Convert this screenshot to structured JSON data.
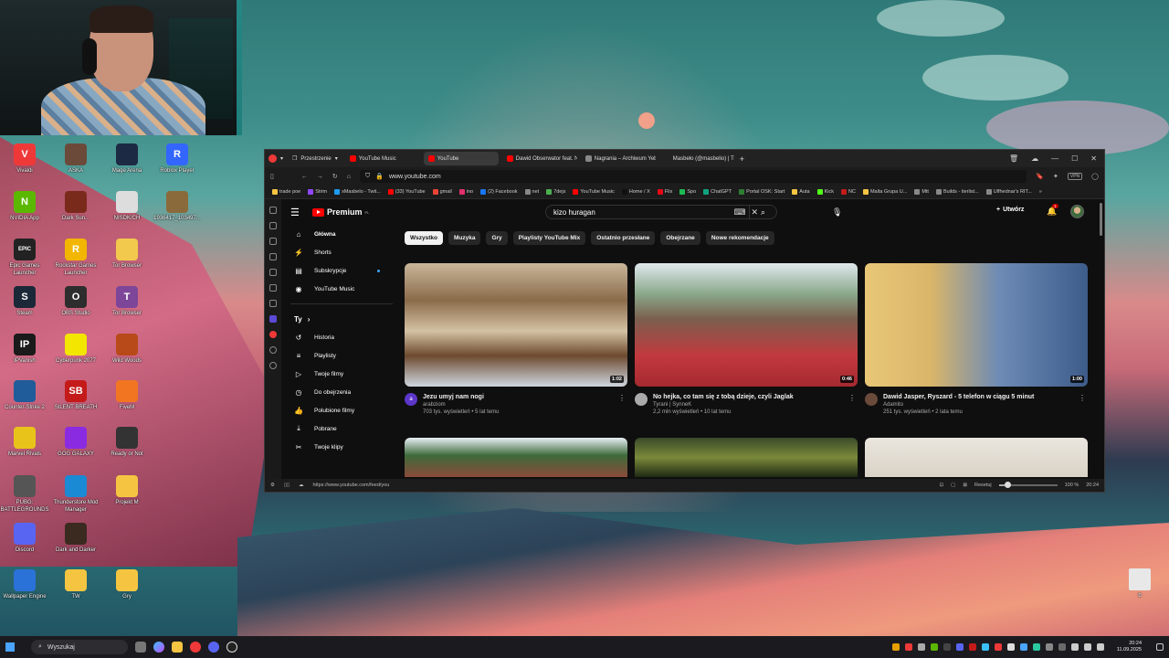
{
  "desktop": {
    "icons": [
      {
        "label": "Vivaldi",
        "color": "#ef3939",
        "glyph": "V"
      },
      {
        "label": "ASKA",
        "color": "#6b4a3a",
        "glyph": ""
      },
      {
        "label": "Mage Arena",
        "color": "#1d2a44",
        "glyph": ""
      },
      {
        "label": "Roblox Player",
        "color": "#3366ff",
        "glyph": "R"
      },
      {
        "label": "NVIDIA App",
        "color": "#5bb800",
        "glyph": "N"
      },
      {
        "label": "Dark Sun...",
        "color": "#7a2a1a",
        "glyph": ""
      },
      {
        "label": "NISDK/CH",
        "color": "#dddddd",
        "glyph": ""
      },
      {
        "label": "1936417_103497...",
        "color": "#8a6a3a",
        "glyph": ""
      },
      {
        "label": "Epic Games Launcher",
        "color": "#222222",
        "glyph": "EPIC"
      },
      {
        "label": "Rockstar Games Launcher",
        "color": "#f2b600",
        "glyph": "R"
      },
      {
        "label": "Tor Browser",
        "color": "#f2c94c",
        "glyph": ""
      },
      {
        "label": "Steam",
        "color": "#1b2838",
        "glyph": "S"
      },
      {
        "label": "OBS Studio",
        "color": "#2d2d2d",
        "glyph": "O"
      },
      {
        "label": "Tor Browser",
        "color": "#7d4698",
        "glyph": "T"
      },
      {
        "label": "IPVanish",
        "color": "#1a1a1a",
        "glyph": "IP"
      },
      {
        "label": "Cyberpunk 2077",
        "color": "#f3e600",
        "glyph": ""
      },
      {
        "label": "Wild Woods",
        "color": "#b84a1a",
        "glyph": ""
      },
      {
        "label": "Counter-Strike 2",
        "color": "#1f5c99",
        "glyph": ""
      },
      {
        "label": "SILENT BREATH",
        "color": "#c41a1a",
        "glyph": "SB"
      },
      {
        "label": "FiveM",
        "color": "#f27521",
        "glyph": ""
      },
      {
        "label": "Marvel Rivals",
        "color": "#e8c31a",
        "glyph": ""
      },
      {
        "label": "GOG GALAXY",
        "color": "#8a2be2",
        "glyph": ""
      },
      {
        "label": "Ready or Not",
        "color": "#333333",
        "glyph": ""
      },
      {
        "label": "PUBG: BATTLEGROUNDS",
        "color": "#555555",
        "glyph": ""
      },
      {
        "label": "Thunderstore Mod Manager",
        "color": "#1b8ad4",
        "glyph": ""
      },
      {
        "label": "Projekt M",
        "color": "#f5c542",
        "glyph": ""
      },
      {
        "label": "Discord",
        "color": "#5865f2",
        "glyph": ""
      },
      {
        "label": "Dark and Darker",
        "color": "#3a2a20",
        "glyph": ""
      },
      {
        "label": "Wallpaper Engine",
        "color": "#2a72d8",
        "glyph": ""
      },
      {
        "label": "TW",
        "color": "#f5c542",
        "glyph": ""
      },
      {
        "label": "Gry",
        "color": "#f5c542",
        "glyph": ""
      }
    ],
    "right_icon_label": "b"
  },
  "browser": {
    "workspace_label": "Przestrzenie",
    "tabs": [
      {
        "title": "YouTube Music",
        "color": "#ff0000"
      },
      {
        "title": "YouTube",
        "color": "#ff0000"
      },
      {
        "title": "Dawid Obserwator feat. Ni...",
        "color": "#ff0000"
      },
      {
        "title": "Nagrania – Archiwum Yebo",
        "color": "#888888"
      },
      {
        "title": "Masbeło (@masbelio) | Tik",
        "color": "#222222"
      }
    ],
    "url": "www.youtube.com",
    "bookmarks": [
      "trade poe",
      "Strim",
      "xMasbelo - Twit...",
      "(33) YouTube",
      "gmail",
      "ino",
      "(2) Facebook",
      "net",
      "7dejs",
      "YouTube Music",
      "Home / X",
      "Flix",
      "Spo",
      "ChatGPT",
      "Portal OSK: Start",
      "Auta",
      "Kick",
      "NC",
      "Malta Grupa U...",
      "Mtt",
      "Builds - tierlist...",
      "Ulfhednar's RIT..."
    ],
    "status_url": "https://www.youtube.com/feed/you",
    "reset_label": "Resetuj",
    "zoom_level": "100 %",
    "zoom_fraction": 0.15,
    "status_time": "20:24"
  },
  "youtube": {
    "logo_text": "Premium",
    "logo_sup": "PL",
    "search_value": "kizo huragan",
    "create_label": "Utwórz",
    "notif_count": "1",
    "sidebar": {
      "main": [
        {
          "label": "Główna",
          "icon": "⌂",
          "name": "home-icon"
        },
        {
          "label": "Shorts",
          "icon": "⚡",
          "name": "shorts-icon"
        },
        {
          "label": "Subskrypcje",
          "icon": "▤",
          "name": "subscriptions-icon"
        },
        {
          "label": "YouTube Music",
          "icon": "◉",
          "name": "youtube-music-icon"
        }
      ],
      "you_header": "Ty",
      "you": [
        {
          "label": "Historia",
          "icon": "↺",
          "name": "history-icon"
        },
        {
          "label": "Playlisty",
          "icon": "≡",
          "name": "playlists-icon"
        },
        {
          "label": "Twoje filmy",
          "icon": "▷",
          "name": "your-videos-icon"
        },
        {
          "label": "Do obejrzenia",
          "icon": "◷",
          "name": "watch-later-icon"
        },
        {
          "label": "Polubione filmy",
          "icon": "👍",
          "name": "liked-icon"
        },
        {
          "label": "Pobrane",
          "icon": "⤓",
          "name": "downloads-icon"
        },
        {
          "label": "Twoje klipy",
          "icon": "✂",
          "name": "clips-icon"
        }
      ]
    },
    "chips": [
      "Wszystko",
      "Muzyka",
      "Gry",
      "Playlisty YouTube Mix",
      "Ostatnio przesłane",
      "Obejrzane",
      "Nowe rekomendacje"
    ],
    "videos": [
      {
        "title": "Jezu umyj nam nogi",
        "channel": "arabziom",
        "views": "703 tys. wyświetleń • 5 lat temu",
        "duration": "1:02",
        "avatar_letter": "a",
        "avatar_color": "#5c35c9"
      },
      {
        "title": "No hejka, co tam się z tobą dzieje, czyli Jaglak",
        "channel": "Tyrani | SynneK",
        "views": "2,2 mln wyświetleń • 10 lat temu",
        "duration": "0:46",
        "avatar_letter": "",
        "avatar_color": "#aaaaaa"
      },
      {
        "title": "Dawid Jasper, Ryszard - 5 telefon w ciągu 5 minut",
        "channel": "Adamito",
        "views": "251 tys. wyświetleń • 2 lata temu",
        "duration": "1:00",
        "avatar_letter": "",
        "avatar_color": "#6a4a3a"
      }
    ]
  },
  "taskbar": {
    "search_label": "Wyszukaj",
    "time": "20:24",
    "date": "11.09.2025"
  }
}
